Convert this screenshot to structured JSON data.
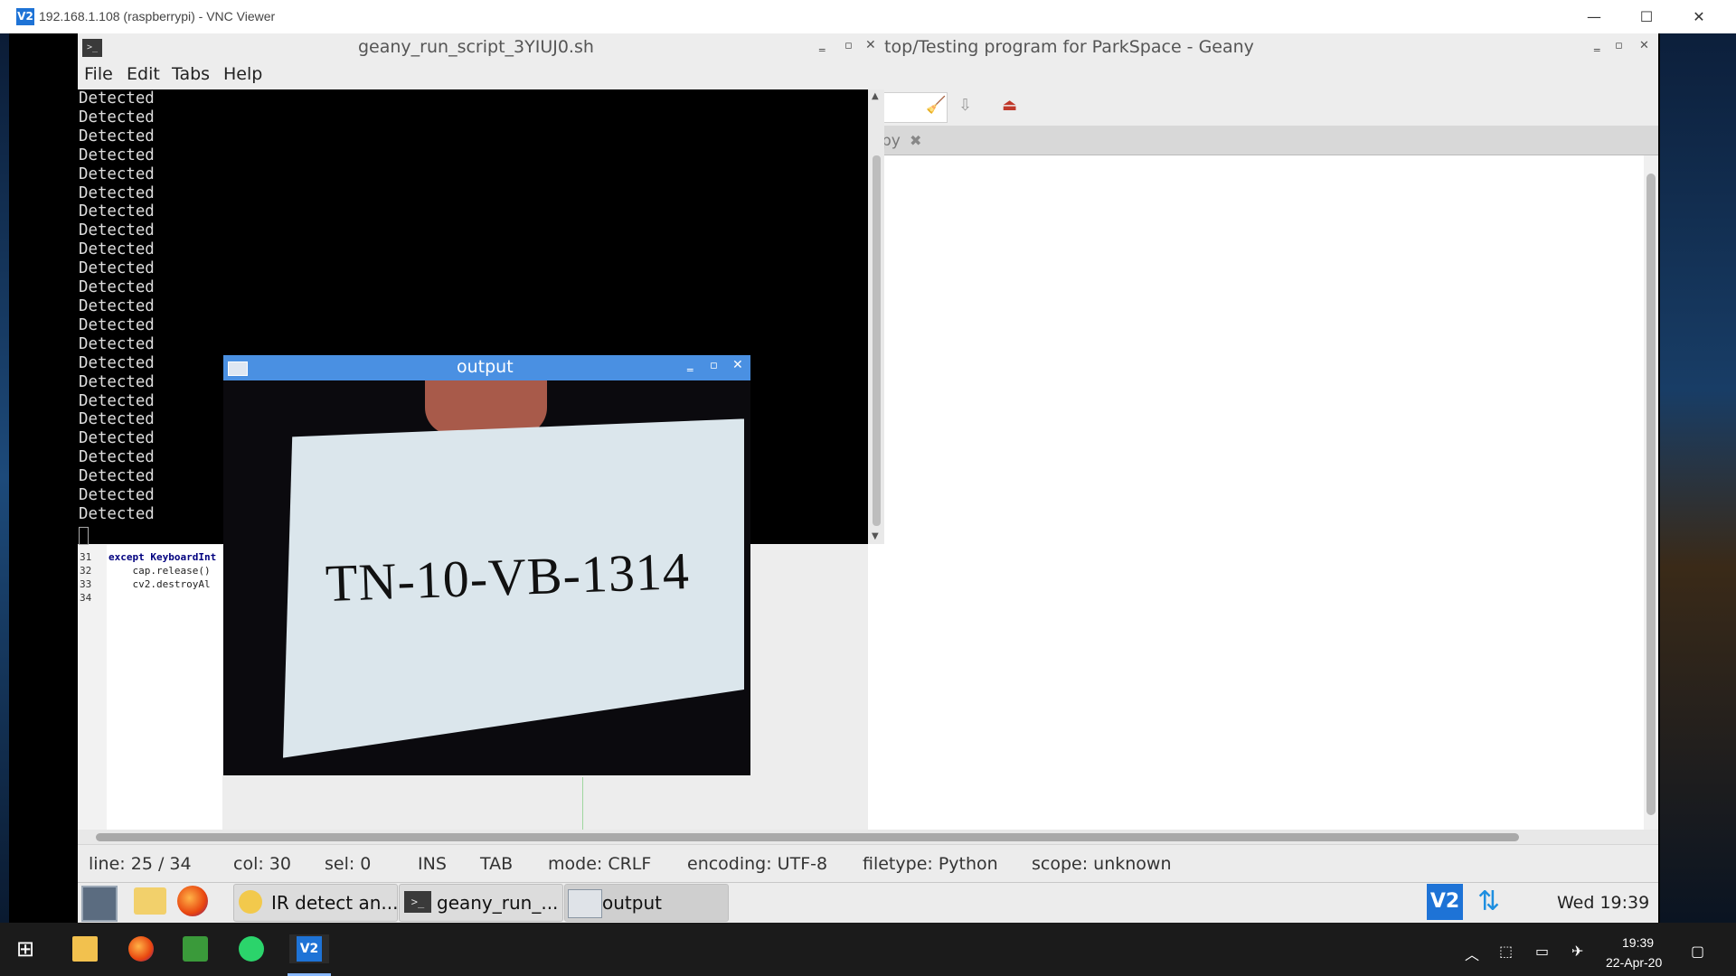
{
  "vnc": {
    "title": "192.168.1.108 (raspberrypi) - VNC Viewer",
    "logo_text": "V2",
    "minimize": "—",
    "maximize": "☐",
    "close": "✕"
  },
  "geany": {
    "title": "top/Testing program for ParkSpace - Geany",
    "tab_label": "py",
    "code_lines": [
      {
        "num": "31",
        "text": "except KeyboardInt"
      },
      {
        "num": "32",
        "text": "    cap.release()"
      },
      {
        "num": "33",
        "text": "    cv2.destroyAl"
      },
      {
        "num": "34",
        "text": ""
      }
    ],
    "status": {
      "line": "line: 25 / 34",
      "col": "col: 30",
      "sel": "sel: 0",
      "ins": "INS",
      "tab": "TAB",
      "mode": "mode: CRLF",
      "encoding": "encoding: UTF-8",
      "filetype": "filetype: Python",
      "scope": "scope: unknown"
    }
  },
  "terminal": {
    "title": "geany_run_script_3YIUJ0.sh",
    "menu": [
      "File",
      "Edit",
      "Tabs",
      "Help"
    ],
    "lines": [
      "Detected",
      "Detected",
      "Detected",
      "Detected",
      "Detected",
      "Detected",
      "Detected",
      "Detected",
      "Detected",
      "Detected",
      "Detected",
      "Detected",
      "Detected",
      "Detected",
      "Detected",
      "Detected",
      "Detected",
      "Detected",
      "Detected",
      "Detected",
      "Detected",
      "Detected",
      "Detected"
    ]
  },
  "output_window": {
    "title": "output",
    "plate_text": "TN-10-VB-1314"
  },
  "panel": {
    "buttons": [
      {
        "label": "IR detect an..."
      },
      {
        "label": "geany_run_..."
      },
      {
        "label": "output"
      }
    ],
    "clock": "Wed 19:39"
  },
  "windows_taskbar": {
    "time": "19:39",
    "date": "22-Apr-20"
  },
  "colors": {
    "output_titlebar": "#4a90e2",
    "vnc_blue": "#1e73d6"
  }
}
